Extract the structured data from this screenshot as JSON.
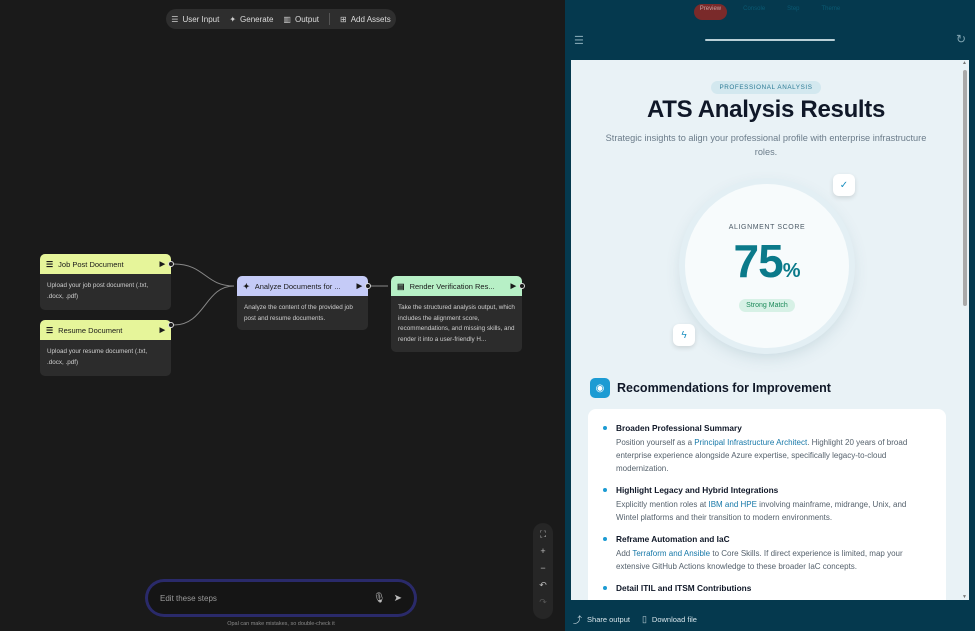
{
  "toolbar": {
    "items": [
      {
        "label": "User Input",
        "icon": "user-input-icon"
      },
      {
        "label": "Generate",
        "icon": "sparkle-icon"
      },
      {
        "label": "Output",
        "icon": "output-icon"
      },
      {
        "label": "Add Assets",
        "icon": "add-assets-icon"
      }
    ]
  },
  "nodes": {
    "job_post": {
      "title": "Job Post Document",
      "body": "Upload your job post document (.txt, .docx, .pdf)",
      "color": "#e6f59a"
    },
    "resume": {
      "title": "Resume Document",
      "body": "Upload your resume document (.txt, .docx, .pdf)",
      "color": "#e6f59a"
    },
    "analyze": {
      "title": "Analyze Documents for ...",
      "body": "Analyze the content of the provided job post and resume documents.",
      "color": "#c5cbf7"
    },
    "render": {
      "title": "Render Verification Res...",
      "body": "Take the structured analysis output, which includes the alignment score, recommendations, and missing skills, and render it into a user-friendly H...",
      "color": "#b7f0c6"
    }
  },
  "prompt": {
    "placeholder": "Edit these steps",
    "disclaimer": "Opal can make mistakes, so double-check it"
  },
  "panel": {
    "tabs": [
      "Preview",
      "Console",
      "Step",
      "Theme"
    ],
    "active_tab": "Preview",
    "bg_color": "#05394e"
  },
  "result": {
    "pill": "PROFESSIONAL ANALYSIS",
    "title": "ATS Analysis Results",
    "subtitle": "Strategic insights to align your professional profile with enterprise infrastructure roles.",
    "score_label": "ALIGNMENT SCORE",
    "score_value": "75",
    "score_unit": "%",
    "score_badge": "Strong Match",
    "rec_title": "Recommendations for Improvement",
    "recommendations": [
      {
        "title": "Broaden Professional Summary",
        "pre": "Position yourself as a ",
        "link": "Principal Infrastructure Architect",
        "post": ". Highlight 20 years of broad enterprise experience alongside Azure expertise, specifically legacy-to-cloud modernization."
      },
      {
        "title": "Highlight Legacy and Hybrid Integrations",
        "pre": "Explicitly mention roles at ",
        "link": "IBM and HPE",
        "post": " involving mainframe, midrange, Unix, and Wintel platforms and their transition to modern environments."
      },
      {
        "title": "Reframe Automation and IaC",
        "pre": "Add ",
        "link": "Terraform and Ansible",
        "post": " to Core Skills. If direct experience is limited, map your extensive GitHub Actions knowledge to these broader IaC concepts."
      },
      {
        "title": "Detail ITIL and ITSM Contributions",
        "pre": "",
        "link": "",
        "post": ""
      }
    ]
  },
  "footer": {
    "share": "Share output",
    "download": "Download file"
  }
}
